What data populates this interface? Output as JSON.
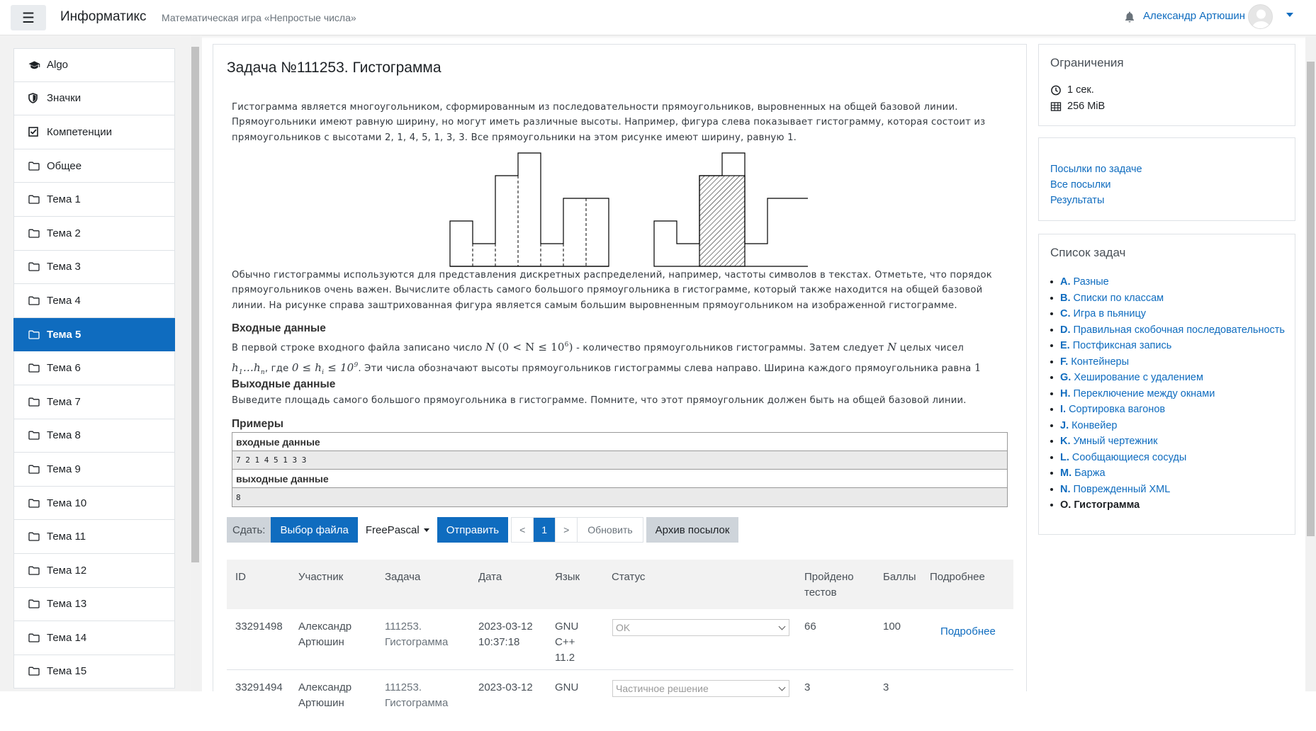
{
  "navbar": {
    "brand": "Информатикс",
    "subtitle": "Математическая игра «Непростые числа»",
    "user_name": "Александр Артюшин"
  },
  "drawer": {
    "items": [
      {
        "label": "Algo",
        "icon": "graduation-cap-icon"
      },
      {
        "label": "Значки",
        "icon": "shield-icon"
      },
      {
        "label": "Компетенции",
        "icon": "checkbox-icon"
      },
      {
        "label": "Общее",
        "icon": "folder-icon"
      },
      {
        "label": "Тема 1",
        "icon": "folder-icon"
      },
      {
        "label": "Тема 2",
        "icon": "folder-icon"
      },
      {
        "label": "Тема 3",
        "icon": "folder-icon"
      },
      {
        "label": "Тема 4",
        "icon": "folder-icon"
      },
      {
        "label": "Тема 5",
        "icon": "folder-icon",
        "active": true
      },
      {
        "label": "Тема 6",
        "icon": "folder-icon"
      },
      {
        "label": "Тема 7",
        "icon": "folder-icon"
      },
      {
        "label": "Тема 8",
        "icon": "folder-icon"
      },
      {
        "label": "Тема 9",
        "icon": "folder-icon"
      },
      {
        "label": "Тема 10",
        "icon": "folder-icon"
      },
      {
        "label": "Тема 11",
        "icon": "folder-icon"
      },
      {
        "label": "Тема 12",
        "icon": "folder-icon"
      },
      {
        "label": "Тема 13",
        "icon": "folder-icon"
      },
      {
        "label": "Тема 14",
        "icon": "folder-icon"
      },
      {
        "label": "Тема 15",
        "icon": "folder-icon"
      }
    ]
  },
  "problem": {
    "title": "Задача №111253. Гистограмма",
    "intro": "Гистограмма является многоугольником, сформированным из последовательности прямоугольников, выровненных на общей базовой линии. Прямоугольники имеют равную ширину, но могут иметь различные высоты. Например, фигура слева показывает гистограмму, которая состоит из прямоугольников с высотами 2, 1, 4, 5, 1, 3, 3. Все прямоугольники на этом рисунке имеют ширину, равную 1.",
    "para2": "Обычно гистограммы используются для представления дискретных распределений, например, частоты символов в текстах. Отметьте, что порядок прямоугольников очень важен. Вычислите область самого большого прямоугольника в гистограмме, который также находится на общей базовой линии. На рисунке справа заштрихованная фигура является самым большим выровненным прямоугольником на изображенной гистограмме.",
    "input_title": "Входные данные",
    "input_p1_a": "В первой строке входного файла записано число",
    "input_p1_b": "- количество прямоугольников гистограммы. Затем следует",
    "input_p1_c": "целых чисел",
    "input_p2_a": ", где",
    "input_p2_b": ". Эти числа обозначают высоты прямоугольников гистограммы слева направо. Ширина каждого прямоугольника равна",
    "math_N": "N",
    "math_cond": "(0 < N ≤ 10",
    "math_cond_exp": "6",
    "math_cond_close": ")",
    "math_h": "h",
    "math_hn": "…h",
    "math_hcond": "0 ≤ h",
    "math_hcond_mid": " ≤ 10",
    "math_hcond_exp": "9",
    "math_one": "1",
    "output_title": "Выходные данные",
    "output_text": "Выведите площадь самого большого прямоугольника в гистограмме. Помните, что этот прямоугольник должен быть на общей базовой линии.",
    "examples_title": "Примеры",
    "ex_input_label": "входные данные",
    "ex_input": "7 2 1 4 5 1 3 3",
    "ex_output_label": "выходные данные",
    "ex_output": "8"
  },
  "histogram": {
    "heights": [
      2,
      1,
      4,
      5,
      1,
      3,
      3
    ],
    "largest_rect": {
      "start": 2,
      "end": 3,
      "height": 4
    }
  },
  "submit": {
    "label": "Сдать:",
    "choose_file": "Выбор файла",
    "language": "FreePascal",
    "send": "Отправить",
    "prev": "<",
    "page": "1",
    "next": ">",
    "refresh": "Обновить",
    "archive": "Архив посылок"
  },
  "submissions": {
    "headers": [
      "ID",
      "Участник",
      "Задача",
      "Дата",
      "Язык",
      "Статус",
      "Пройдено тестов",
      "Баллы",
      "Подробнее"
    ],
    "rows": [
      {
        "id": "33291498",
        "user": "Александр Артюшин",
        "task": "111253. Гистограмма",
        "date": "2023-03-12 10:37:18",
        "lang": "GNU C++ 11.2",
        "status": "OK",
        "tests": "66",
        "score": "100",
        "details": "Подробнее"
      },
      {
        "id": "33291494",
        "user": "Александр Артюшин",
        "task": "111253. Гистограмма",
        "date": "2023-03-12",
        "lang": "GNU",
        "status": "Частичное решение",
        "tests": "3",
        "score": "3",
        "details": ""
      }
    ]
  },
  "limits": {
    "title": "Ограничения",
    "time": "1 сек.",
    "memory": "256 MiB"
  },
  "links": {
    "by_task": "Посылки по задаче",
    "all": "Все посылки",
    "results": "Результаты"
  },
  "task_list": {
    "title": "Список задач",
    "items": [
      {
        "letter": "A.",
        "name": "Разные"
      },
      {
        "letter": "B.",
        "name": "Списки по классам"
      },
      {
        "letter": "C.",
        "name": "Игра в пьяницу"
      },
      {
        "letter": "D.",
        "name": "Правильная скобочная последовательность"
      },
      {
        "letter": "E.",
        "name": "Постфиксная запись"
      },
      {
        "letter": "F.",
        "name": "Контейнеры"
      },
      {
        "letter": "G.",
        "name": "Хеширование с удалением"
      },
      {
        "letter": "H.",
        "name": "Переключение между окнами"
      },
      {
        "letter": "I.",
        "name": "Сортировка вагонов"
      },
      {
        "letter": "J.",
        "name": "Конвейер"
      },
      {
        "letter": "K.",
        "name": "Умный чертежник"
      },
      {
        "letter": "L.",
        "name": "Сообщающиеся сосуды"
      },
      {
        "letter": "M.",
        "name": "Баржа"
      },
      {
        "letter": "N.",
        "name": "Поврежденный XML"
      },
      {
        "letter": "O.",
        "name": "Гистограмма",
        "current": true
      }
    ]
  },
  "colors": {
    "accent": "#0f6cbf",
    "grey_btn": "#ced4da"
  }
}
